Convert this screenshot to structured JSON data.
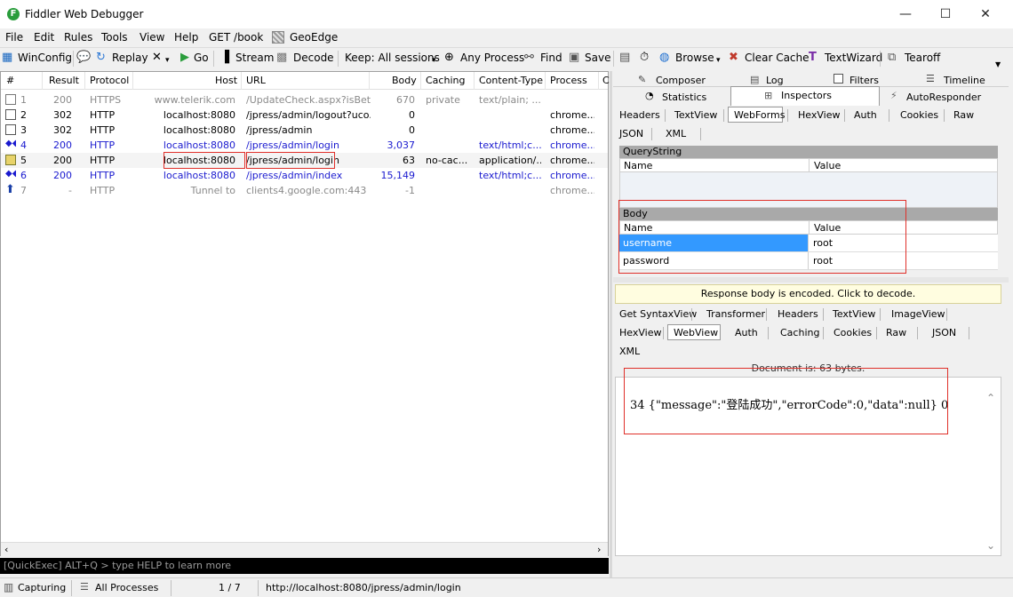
{
  "window": {
    "title": "Fiddler Web Debugger",
    "minimize_glyph": "—",
    "maximize_glyph": "☐",
    "close_glyph": "✕"
  },
  "menu": [
    "File",
    "Edit",
    "Rules",
    "Tools",
    "View",
    "Help",
    "GET /book",
    "GeoEdge"
  ],
  "toolbar": {
    "winconfig": "WinConfig",
    "replay": "Replay",
    "go": "Go",
    "stream": "Stream",
    "decode": "Decode",
    "keep": "Keep: All sessions",
    "any_process": "Any Process",
    "find": "Find",
    "save": "Save",
    "browse": "Browse",
    "clear_cache": "Clear Cache",
    "textwizard": "TextWizard",
    "tearoff": "Tearoff"
  },
  "sessions": {
    "columns": [
      "#",
      "Result",
      "Protocol",
      "Host",
      "URL",
      "Body",
      "Caching",
      "Content-Type",
      "Process",
      "C"
    ],
    "rows": [
      {
        "num": "1",
        "result": "200",
        "protocol": "HTTPS",
        "host": "www.telerik.com",
        "url": "/UpdateCheck.aspx?isBet...",
        "body": "670",
        "caching": "private",
        "ctype": "text/plain; ...",
        "process": ""
      },
      {
        "num": "2",
        "result": "302",
        "protocol": "HTTP",
        "host": "localhost:8080",
        "url": "/jpress/admin/logout?uco...",
        "body": "0",
        "caching": "",
        "ctype": "",
        "process": "chrome..."
      },
      {
        "num": "3",
        "result": "302",
        "protocol": "HTTP",
        "host": "localhost:8080",
        "url": "/jpress/admin",
        "body": "0",
        "caching": "",
        "ctype": "",
        "process": "chrome..."
      },
      {
        "num": "4",
        "result": "200",
        "protocol": "HTTP",
        "host": "localhost:8080",
        "url": "/jpress/admin/login",
        "body": "3,037",
        "caching": "",
        "ctype": "text/html;c...",
        "process": "chrome..."
      },
      {
        "num": "5",
        "result": "200",
        "protocol": "HTTP",
        "host": "localhost:8080",
        "url": "/jpress/admin/login",
        "body": "63",
        "caching": "no-cac...",
        "ctype": "application/...",
        "process": "chrome..."
      },
      {
        "num": "6",
        "result": "200",
        "protocol": "HTTP",
        "host": "localhost:8080",
        "url": "/jpress/admin/index",
        "body": "15,149",
        "caching": "",
        "ctype": "text/html;c...",
        "process": "chrome..."
      },
      {
        "num": "7",
        "result": "-",
        "protocol": "HTTP",
        "host": "Tunnel to",
        "url": "clients4.google.com:443",
        "body": "-1",
        "caching": "",
        "ctype": "",
        "process": "chrome..."
      }
    ]
  },
  "quickexec": "[QuickExec] ALT+Q > type HELP to learn more",
  "status": {
    "capturing": "Capturing",
    "processes": "All Processes",
    "count": "1 / 7",
    "url": "http://localhost:8080/jpress/admin/login"
  },
  "right_tabs": {
    "row1": [
      "Composer",
      "Log",
      "Filters",
      "Timeline"
    ],
    "row2": [
      "Statistics",
      "Inspectors",
      "AutoResponder"
    ]
  },
  "request_tabs": [
    "Headers",
    "TextView",
    "WebForms",
    "HexView",
    "Auth",
    "Cookies",
    "Raw",
    "JSON",
    "XML"
  ],
  "querystring": {
    "title": "QueryString",
    "name_col": "Name",
    "value_col": "Value"
  },
  "body_grid": {
    "title": "Body",
    "name_col": "Name",
    "value_col": "Value",
    "rows": [
      {
        "name": "username",
        "value": "root"
      },
      {
        "name": "password",
        "value": "root"
      }
    ]
  },
  "response": {
    "encoded_notice": "Response body is encoded. Click to decode.",
    "tabs": [
      "Get SyntaxView",
      "Transformer",
      "Headers",
      "TextView",
      "ImageView",
      "HexView",
      "WebView",
      "Auth",
      "Caching",
      "Cookies",
      "Raw",
      "JSON",
      "XML"
    ],
    "doc_info": "Document is: 63 bytes.",
    "webview_text": "34 {\"message\":\"登陆成功\",\"errorCode\":0,\"data\":null} 0"
  },
  "colors": {
    "selected_row": "#3399ff",
    "red_highlight": "#e0302a",
    "blue_text": "#1a1acf"
  }
}
